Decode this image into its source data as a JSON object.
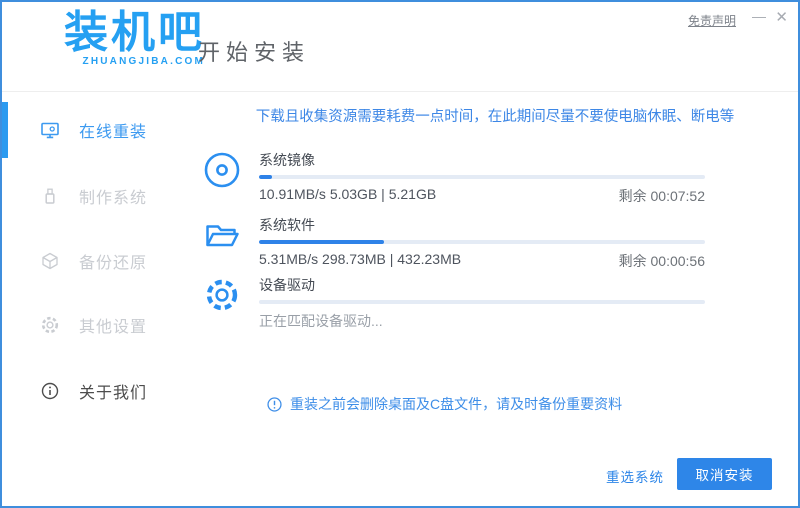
{
  "logo": {
    "title": "装机吧",
    "subtitle": "ZHUANGJIBA.COM"
  },
  "header": {
    "title": "开始安装",
    "disclaimer": "免责声明",
    "minimize_glyph": "—",
    "close_glyph": "✕"
  },
  "sidebar": {
    "items": [
      {
        "label": "在线重装",
        "icon": "monitor-icon",
        "active": true
      },
      {
        "label": "制作系统",
        "icon": "usb-icon",
        "active": false
      },
      {
        "label": "备份还原",
        "icon": "backup-cube-icon",
        "active": false
      },
      {
        "label": "其他设置",
        "icon": "gear-icon",
        "active": false
      },
      {
        "label": "关于我们",
        "icon": "info-icon",
        "active": false
      }
    ]
  },
  "main": {
    "notice": "下载且收集资源需要耗费一点时间，在此期间尽量不要使电脑休眠、断电等",
    "tasks": [
      {
        "name": "系统镜像",
        "icon": "disc-icon",
        "progress_pct": 3,
        "stats": "10.91MB/s 5.03GB | 5.21GB",
        "remaining": "剩余 00:07:52"
      },
      {
        "name": "系统软件",
        "icon": "folder-icon",
        "progress_pct": 28,
        "stats": "5.31MB/s 298.73MB | 432.23MB",
        "remaining": "剩余 00:00:56"
      },
      {
        "name": "设备驱动",
        "icon": "gear-icon",
        "progress_pct": 0,
        "stats": "正在匹配设备驱动...",
        "remaining": ""
      }
    ],
    "tip": "重装之前会删除桌面及C盘文件，请及时备份重要资料"
  },
  "footer": {
    "reselect_label": "重选系统",
    "cancel_label": "取消安装"
  },
  "colors": {
    "accent_blue": "#2e86e8",
    "logo_blue": "#25a0f2",
    "notice_blue": "#3d87e6",
    "window_border": "#3f8edd",
    "progress_track": "#e4ebf5",
    "progress_fill": "#2e82e8",
    "inactive_gray": "#c9ccd1",
    "remaining_gray": "#6d7278"
  }
}
